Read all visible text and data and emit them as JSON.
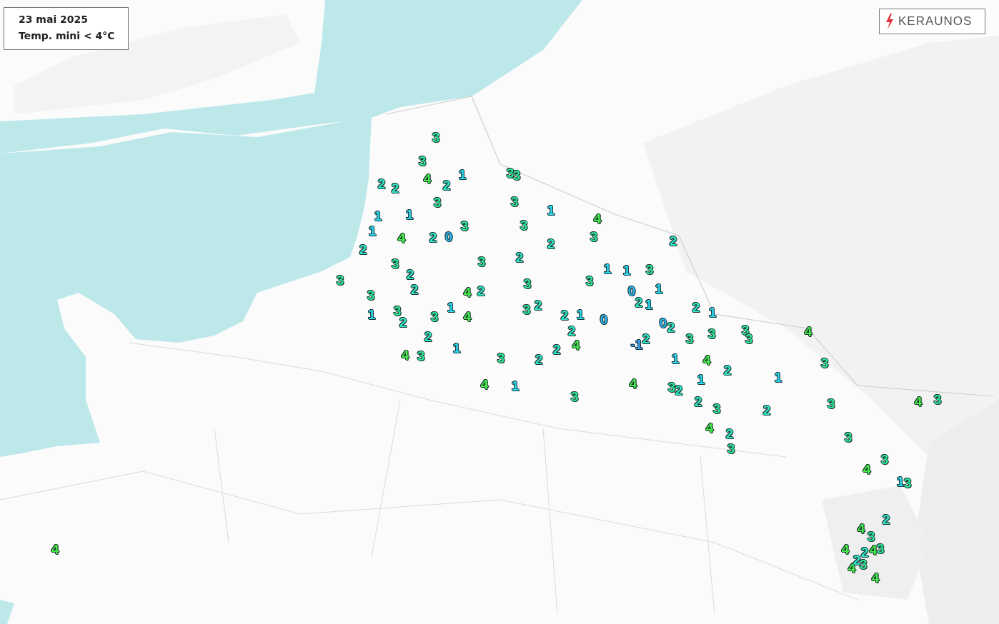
{
  "legend": {
    "date": "23 mai 2025",
    "subtitle": "Temp. mini < 4°C"
  },
  "logo": {
    "text": "KERAUNOS"
  },
  "stations": [
    {
      "value": "3",
      "color": "#2ee89a"
    },
    {
      "value": "3",
      "color": "#2ee89a"
    },
    {
      "value": "2",
      "color": "#2ee8c8"
    },
    {
      "value": "2",
      "color": "#2ee8c8"
    },
    {
      "value": "4",
      "color": "#44e84a"
    },
    {
      "value": "2",
      "color": "#2ee8c8"
    },
    {
      "value": "1",
      "color": "#2ad8f0"
    },
    {
      "value": "3",
      "color": "#2ee89a"
    },
    {
      "value": "3",
      "color": "#2ee89a"
    },
    {
      "value": "3",
      "color": "#2ee89a"
    },
    {
      "value": "3",
      "color": "#2ee89a"
    },
    {
      "value": "1",
      "color": "#2ad8f0"
    },
    {
      "value": "1",
      "color": "#2ad8f0"
    },
    {
      "value": "1",
      "color": "#2ad8f0"
    },
    {
      "value": "4",
      "color": "#44e84a"
    },
    {
      "value": "1",
      "color": "#2ad8f0"
    },
    {
      "value": "4",
      "color": "#44e84a"
    },
    {
      "value": "2",
      "color": "#2ee8c8"
    },
    {
      "value": "0",
      "color": "#29b8f0"
    },
    {
      "value": "3",
      "color": "#2ee89a"
    },
    {
      "value": "3",
      "color": "#2ee89a"
    },
    {
      "value": "2",
      "color": "#2ee8c8"
    },
    {
      "value": "3",
      "color": "#2ee89a"
    },
    {
      "value": "2",
      "color": "#2ee8c8"
    },
    {
      "value": "2",
      "color": "#2ee8c8"
    },
    {
      "value": "3",
      "color": "#2ee89a"
    },
    {
      "value": "3",
      "color": "#2ee89a"
    },
    {
      "value": "2",
      "color": "#2ee8c8"
    },
    {
      "value": "1",
      "color": "#2ad8f0"
    },
    {
      "value": "1",
      "color": "#2ad8f0"
    },
    {
      "value": "3",
      "color": "#2ee89a"
    },
    {
      "value": "2",
      "color": "#2ee8c8"
    },
    {
      "value": "3",
      "color": "#2ee89a"
    },
    {
      "value": "3",
      "color": "#2ee89a"
    },
    {
      "value": "3",
      "color": "#2ee89a"
    },
    {
      "value": "3",
      "color": "#2ee89a"
    },
    {
      "value": "2",
      "color": "#2ee8c8"
    },
    {
      "value": "4",
      "color": "#44e84a"
    },
    {
      "value": "2",
      "color": "#2ee8c8"
    },
    {
      "value": "0",
      "color": "#29b8f0"
    },
    {
      "value": "1",
      "color": "#2ad8f0"
    },
    {
      "value": "2",
      "color": "#2ee8c8"
    },
    {
      "value": "2",
      "color": "#2ee8c8"
    },
    {
      "value": "1",
      "color": "#2ad8f0"
    },
    {
      "value": "1",
      "color": "#2ad8f0"
    },
    {
      "value": "3",
      "color": "#2ee89a"
    },
    {
      "value": "2",
      "color": "#2ee8c8"
    },
    {
      "value": "3",
      "color": "#2ee89a"
    },
    {
      "value": "1",
      "color": "#2ad8f0"
    },
    {
      "value": "4",
      "color": "#44e84a"
    },
    {
      "value": "3",
      "color": "#2ee89a"
    },
    {
      "value": "2",
      "color": "#2ee8c8"
    },
    {
      "value": "1",
      "color": "#2ad8f0"
    },
    {
      "value": "0",
      "color": "#29b8f0"
    },
    {
      "value": "0",
      "color": "#29b8f0"
    },
    {
      "value": "2",
      "color": "#2ee8c8"
    },
    {
      "value": "1",
      "color": "#2ad8f0"
    },
    {
      "value": "2",
      "color": "#2ee8c8"
    },
    {
      "value": "2",
      "color": "#2ee8c8"
    },
    {
      "value": "2",
      "color": "#2ee8c8"
    },
    {
      "value": "2",
      "color": "#2ee8c8"
    },
    {
      "value": "3",
      "color": "#2ee89a"
    },
    {
      "value": "3",
      "color": "#2ee89a"
    },
    {
      "value": "3",
      "color": "#2ee89a"
    },
    {
      "value": "3",
      "color": "#2ee89a"
    },
    {
      "value": "4",
      "color": "#44e84a"
    },
    {
      "value": "1",
      "color": "#2ad8f0"
    },
    {
      "value": "2",
      "color": "#2ee8c8"
    },
    {
      "value": "4",
      "color": "#44e84a"
    },
    {
      "value": "-1",
      "color": "#3aa0f0"
    },
    {
      "value": "4",
      "color": "#44e84a"
    },
    {
      "value": "3",
      "color": "#2ee89a"
    },
    {
      "value": "3",
      "color": "#2ee89a"
    },
    {
      "value": "2",
      "color": "#2ee8c8"
    },
    {
      "value": "1",
      "color": "#2ad8f0"
    },
    {
      "value": "4",
      "color": "#44e84a"
    },
    {
      "value": "3",
      "color": "#2ee89a"
    },
    {
      "value": "4",
      "color": "#44e84a"
    },
    {
      "value": "1",
      "color": "#2ad8f0"
    },
    {
      "value": "4",
      "color": "#44e84a"
    },
    {
      "value": "3",
      "color": "#2ee89a"
    },
    {
      "value": "2",
      "color": "#2ee8c8"
    },
    {
      "value": "1",
      "color": "#2ad8f0"
    },
    {
      "value": "2",
      "color": "#2ee8c8"
    },
    {
      "value": "1",
      "color": "#2ad8f0"
    },
    {
      "value": "3",
      "color": "#2ee89a"
    },
    {
      "value": "2",
      "color": "#2ee8c8"
    },
    {
      "value": "3",
      "color": "#2ee89a"
    },
    {
      "value": "2",
      "color": "#2ee8c8"
    },
    {
      "value": "3",
      "color": "#2ee89a"
    },
    {
      "value": "4",
      "color": "#44e84a"
    },
    {
      "value": "3",
      "color": "#2ee89a"
    },
    {
      "value": "4",
      "color": "#44e84a"
    },
    {
      "value": "2",
      "color": "#2ee8c8"
    },
    {
      "value": "3",
      "color": "#2ee89a"
    },
    {
      "value": "3",
      "color": "#2ee89a"
    },
    {
      "value": "3",
      "color": "#2ee89a"
    },
    {
      "value": "4",
      "color": "#44e84a"
    },
    {
      "value": "1",
      "color": "#2ad8f0"
    },
    {
      "value": "3",
      "color": "#2ee89a"
    },
    {
      "value": "2",
      "color": "#2ee8c8"
    },
    {
      "value": "4",
      "color": "#44e84a"
    },
    {
      "value": "3",
      "color": "#2ee89a"
    },
    {
      "value": "4",
      "color": "#44e84a"
    },
    {
      "value": "4",
      "color": "#44e84a"
    },
    {
      "value": "2",
      "color": "#2ee8c8"
    },
    {
      "value": "4",
      "color": "#44e84a"
    },
    {
      "value": "3",
      "color": "#2ee89a"
    },
    {
      "value": "4",
      "color": "#44e84a"
    },
    {
      "value": "2",
      "color": "#2ee8c8"
    },
    {
      "value": "3",
      "color": "#2ee89a"
    },
    {
      "value": "4",
      "color": "#44e84a"
    }
  ]
}
